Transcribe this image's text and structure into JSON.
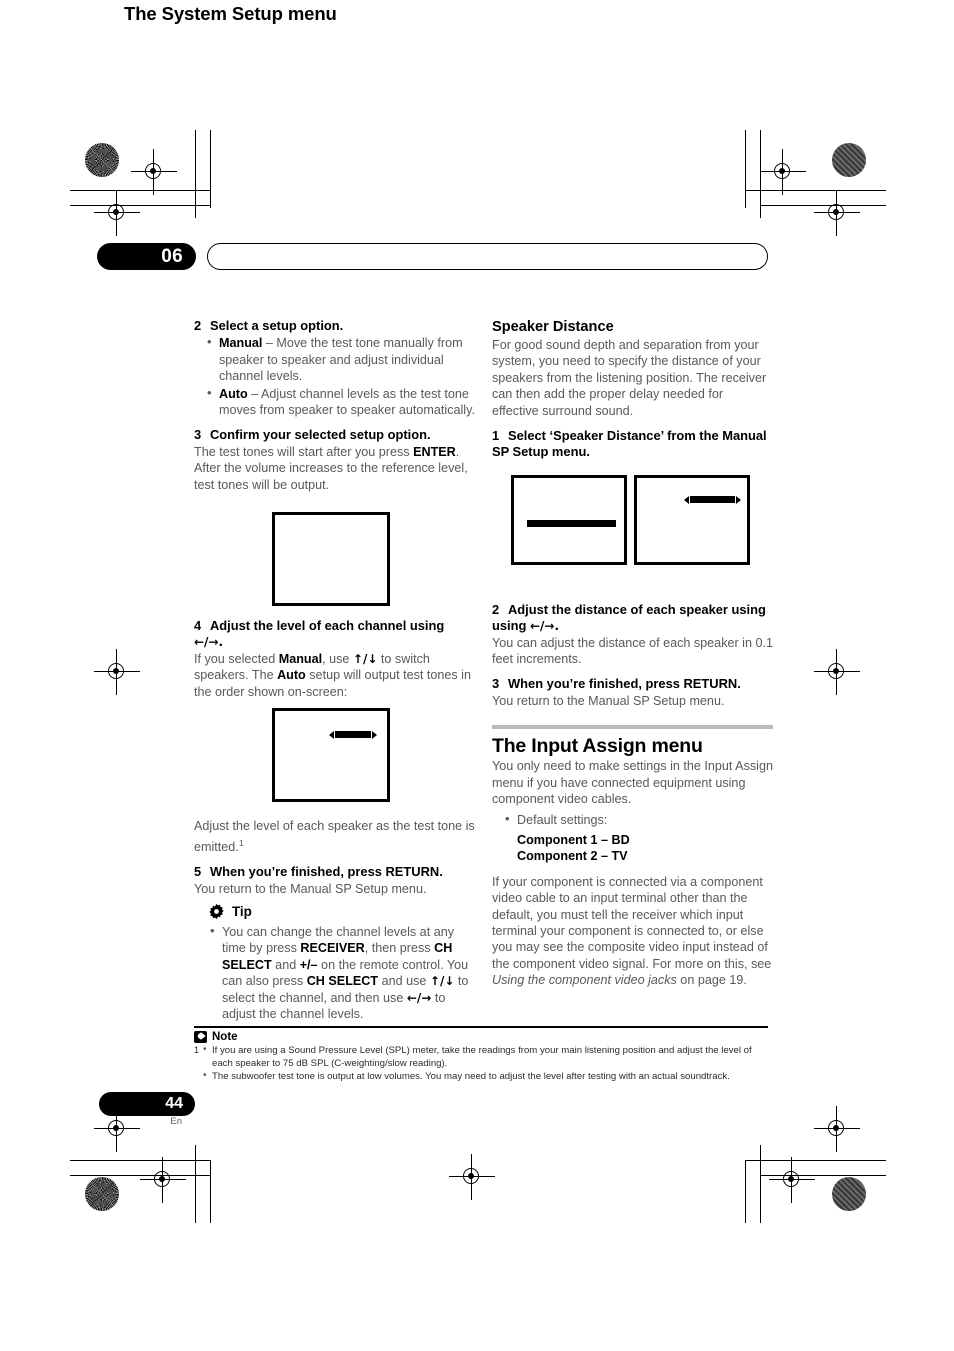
{
  "chapter": {
    "number": "06",
    "title": "The System Setup menu"
  },
  "left_column": {
    "step2_heading_num": "2",
    "step2_heading": "Select a setup option.",
    "step2_bullets": [
      {
        "bold": "Manual",
        "rest": " – Move the test tone manually from speaker to speaker and adjust individual channel levels."
      },
      {
        "bold": "Auto",
        "rest": " – Adjust channel levels as the test tone moves from speaker to speaker automatically."
      }
    ],
    "step3_heading_num": "3",
    "step3_heading": "Confirm your selected setup option.",
    "step3_body_1": "The test tones will start after you press ",
    "step3_body_bold": "ENTER",
    "step3_body_2": ". After the volume increases to the reference level, test tones will be output.",
    "step4_heading_num": "4",
    "step4_heading": "Adjust the level of each channel using",
    "step4_heading_arrows": "←/→.",
    "step4_body_1": "If you selected ",
    "step4_body_b1": "Manual",
    "step4_body_2": ", use ",
    "step4_body_arrows1": "↑/↓",
    "step4_body_3": " to switch speakers. The ",
    "step4_body_b2": "Auto",
    "step4_body_4": " setup will output test tones in the order shown on-screen:",
    "after_screen_text_1": "Adjust the level of each speaker as the test tone is emitted.",
    "after_screen_footnote": "1",
    "step5_heading_num": "5",
    "step5_heading": "When you’re finished, press RETURN.",
    "step5_body": "You return to the Manual SP Setup menu."
  },
  "tip": {
    "label": "Tip",
    "icon": "gear-icon",
    "bullet_parts": [
      "You can change the channel levels at any time by press ",
      "RECEIVER",
      ", then press ",
      "CH SELECT",
      " and ",
      "+/–",
      " on the remote control. You can also press ",
      "CH SELECT",
      " and use ",
      "↑/↓",
      " to select the channel, and then use ",
      "←/→",
      " to adjust the channel levels."
    ]
  },
  "right_column": {
    "speaker_distance_title": "Speaker Distance",
    "speaker_distance_body": "For good sound depth and separation from your system, you need to specify the distance of your speakers from the listening position. The receiver can then add the proper delay needed for effective surround sound.",
    "sd_step1_num": "1",
    "sd_step1_heading": "Select ‘Speaker Distance’ from the Manual SP Setup menu.",
    "sd_step2_num": "2",
    "sd_step2_heading": "Adjust the distance of each speaker using",
    "sd_step2_heading_arrows": "←/→.",
    "sd_step2_body": "You can adjust the distance of each speaker in 0.1 feet increments.",
    "sd_step3_num": "3",
    "sd_step3_heading": "When you’re finished, press RETURN.",
    "sd_step3_body": "You return to the Manual SP Setup menu.",
    "input_assign_title": "The Input Assign menu",
    "input_assign_body": "You only need to make settings in the Input Assign menu if you have connected equipment using component video cables.",
    "default_settings_label": "Default settings:",
    "default_1_bold": "Component 1",
    "default_1_rest": " – BD",
    "default_2_bold": "Component 2",
    "default_2_rest": " – TV",
    "input_assign_body_2a": "If your component is connected via a component video cable to an input terminal other than the default, you must tell the receiver which input terminal your component is connected to, or else you may see the composite video input instead of the component video signal. For more on this, see ",
    "input_assign_italic": "Using the component video jacks",
    "input_assign_body_2b": " on page 19."
  },
  "note": {
    "label": "Note",
    "icon": "note-pen-icon",
    "footnote_number": "1",
    "items": [
      "If you are using a Sound Pressure Level (SPL) meter, take the readings from your main listening position and adjust the level of each speaker to 75 dB SPL (C-weighting/slow reading).",
      "The subwoofer test tone is output at low volumes. You may need to adjust the level after testing with an actual soundtrack."
    ]
  },
  "footer": {
    "page_number": "44",
    "language": "En"
  },
  "screens": {
    "left_screen_1_name": "test-tone-screen-empty",
    "left_screen_2_name": "test-tone-screen-bar",
    "right_screen_1_name": "speaker-distance-screen-list",
    "right_screen_2_name": "speaker-distance-screen-adjust"
  },
  "colors": {
    "body_text": "#58595b",
    "heading": "#000000",
    "rule": "#b9babc"
  }
}
